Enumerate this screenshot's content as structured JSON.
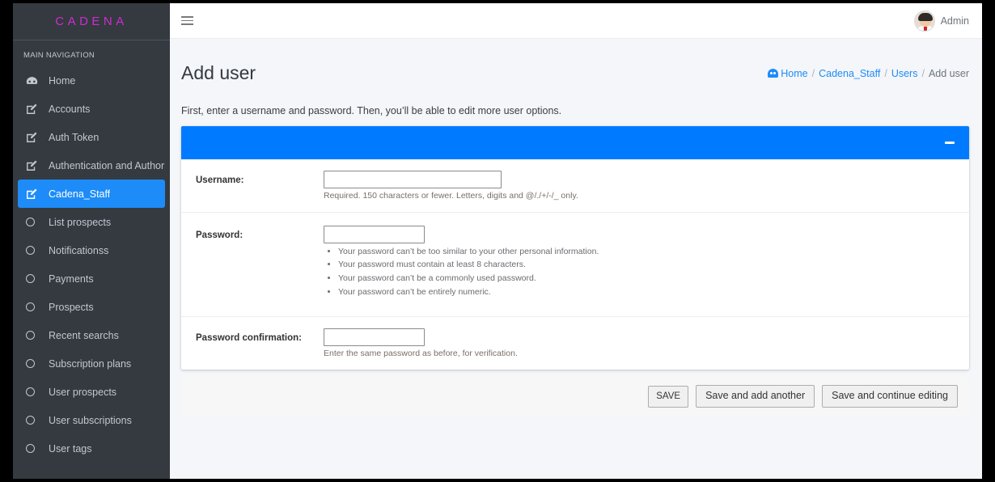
{
  "colors": {
    "sidebar_bg": "#343a40",
    "brand": "#d12ad1",
    "accent": "#007bff",
    "active_item": "#1d8cf8",
    "page_bg": "#f4f6f9"
  },
  "sidebar": {
    "brand": "CADENA",
    "nav_header": "MAIN NAVIGATION",
    "items": [
      {
        "label": "Home",
        "icon": "dashboard-icon",
        "active": false
      },
      {
        "label": "Accounts",
        "icon": "edit-square-icon",
        "active": false
      },
      {
        "label": "Auth Token",
        "icon": "edit-square-icon",
        "active": false
      },
      {
        "label": "Authentication and Authoriz",
        "icon": "edit-square-icon",
        "active": false
      },
      {
        "label": "Cadena_Staff",
        "icon": "edit-square-icon",
        "active": true
      },
      {
        "label": "List prospects",
        "icon": "circle-icon",
        "active": false
      },
      {
        "label": "Notificationss",
        "icon": "circle-icon",
        "active": false
      },
      {
        "label": "Payments",
        "icon": "circle-icon",
        "active": false
      },
      {
        "label": "Prospects",
        "icon": "circle-icon",
        "active": false
      },
      {
        "label": "Recent searchs",
        "icon": "circle-icon",
        "active": false
      },
      {
        "label": "Subscription plans",
        "icon": "circle-icon",
        "active": false
      },
      {
        "label": "User prospects",
        "icon": "circle-icon",
        "active": false
      },
      {
        "label": "User subscriptions",
        "icon": "circle-icon",
        "active": false
      },
      {
        "label": "User tags",
        "icon": "circle-icon",
        "active": false
      }
    ]
  },
  "topbar": {
    "menu_icon": "hamburger-icon",
    "user_name": "Admin",
    "avatar_icon": "user-avatar"
  },
  "page": {
    "title": "Add user",
    "intro": "First, enter a username and password. Then, you’ll be able to edit more user options.",
    "breadcrumb": [
      {
        "label": "Home",
        "icon": "dashboard-icon",
        "current": false
      },
      {
        "label": "Cadena_Staff",
        "current": false
      },
      {
        "label": "Users",
        "current": false
      },
      {
        "label": "Add user",
        "current": true
      }
    ],
    "breadcrumb_separator": "/"
  },
  "card": {
    "collapse_icon": "minus-icon",
    "fields": [
      {
        "label": "Username:",
        "value": "",
        "placeholder": "",
        "help": "Required. 150 characters or fewer. Letters, digits and @/./+/-/_ only.",
        "input_width": "wide"
      },
      {
        "label": "Password:",
        "value": "",
        "placeholder": "",
        "input_width": "narrow",
        "help_list": [
          "Your password can’t be too similar to your other personal information.",
          "Your password must contain at least 8 characters.",
          "Your password can’t be a commonly used password.",
          "Your password can’t be entirely numeric."
        ]
      },
      {
        "label": "Password confirmation:",
        "value": "",
        "placeholder": "",
        "help": "Enter the same password as before, for verification.",
        "input_width": "narrow"
      }
    ]
  },
  "submit_row": {
    "save": "SAVE",
    "save_and_add_another": "Save and add another",
    "save_and_continue": "Save and continue editing"
  }
}
